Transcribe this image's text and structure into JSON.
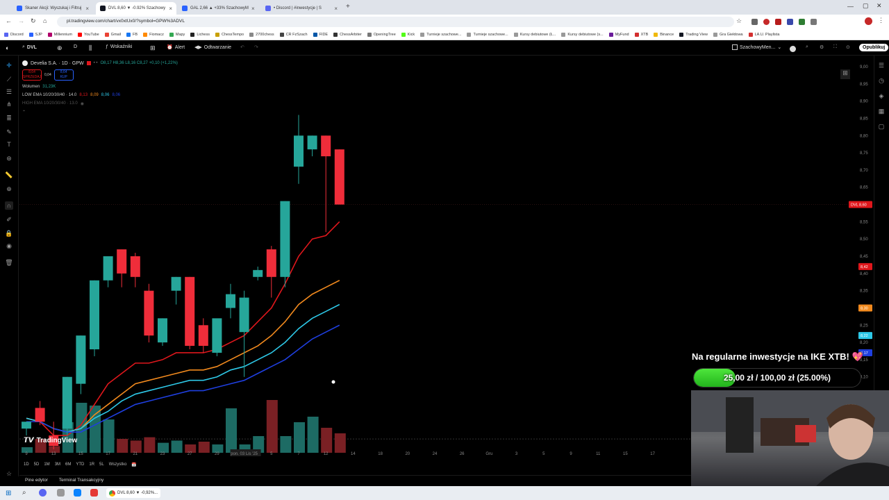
{
  "browser": {
    "tabs": [
      {
        "label": "Skaner Akcji: Wyszukaj i Filtruj",
        "color": "#2962ff"
      },
      {
        "label": "DVL 8,60 ▼ -0.92% Szachowy",
        "color": "#131722",
        "active": true
      },
      {
        "label": "GAL 2,66 ▲ +33% SzachowyM",
        "color": "#2962ff"
      },
      {
        "label": "• Discord | #inwestycje | S",
        "color": "#5865f2"
      }
    ],
    "url": "pl.tradingview.com/chart/vx0xtUx0/?symbol=GPW%3ADVL",
    "bookmarks": [
      {
        "label": "Discord",
        "color": "#5865f2"
      },
      {
        "label": "SJP",
        "color": "#2962ff"
      },
      {
        "label": "Millennium",
        "color": "#b0006a"
      },
      {
        "label": "YouTube",
        "color": "#ff0000"
      },
      {
        "label": "Gmail",
        "color": "#ea4335"
      },
      {
        "label": "FB",
        "color": "#1877f2"
      },
      {
        "label": "Fiomacz",
        "color": "#ff8a00"
      },
      {
        "label": "Mapy",
        "color": "#34a853"
      },
      {
        "label": "Lichess",
        "color": "#222"
      },
      {
        "label": "ChessTempo",
        "color": "#c8a000"
      },
      {
        "label": "2700chess",
        "color": "#888"
      },
      {
        "label": "CR FzSzach",
        "color": "#444"
      },
      {
        "label": "FIDE",
        "color": "#0057a8"
      },
      {
        "label": "ChessArbiter",
        "color": "#333"
      },
      {
        "label": "OpeningTree",
        "color": "#777"
      },
      {
        "label": "Kick",
        "color": "#53fc18"
      },
      {
        "label": "Turnieje szachowe...",
        "color": "#999"
      },
      {
        "label": "Turnieje szachowe...",
        "color": "#999"
      },
      {
        "label": "Kursy debiutowe (Ł...",
        "color": "#999"
      },
      {
        "label": "Kursy debiutowe (s...",
        "color": "#999"
      },
      {
        "label": "MyFund",
        "color": "#6a1b9a"
      },
      {
        "label": "XTB",
        "color": "#d32f2f"
      },
      {
        "label": "Binance",
        "color": "#f0b90b"
      },
      {
        "label": "Trading View",
        "color": "#131722"
      },
      {
        "label": "Gra Giełdowa",
        "color": "#999"
      },
      {
        "label": "LA.U. Playlista",
        "color": "#d32f2f"
      }
    ]
  },
  "toolbar": {
    "symbol": "DVL",
    "interval": "D",
    "indicators": "Wskaźniki",
    "alert": "Alert",
    "replay": "Odtwarzanie",
    "account": "SzachowyMen...",
    "publish": "Opublikuj"
  },
  "legend": {
    "symbol_title": "Develia S.A. · 1D · GPW",
    "ohlc": "O8,17 H8,36 L8,16 C8,27 +0,10 (+1,22%)",
    "volume_label": "Wolumen",
    "volume_value": "31,23K",
    "sell_price": "8,64",
    "sell_label": "SPRZEDAJ",
    "spread": "0,04",
    "buy_price": "8,64",
    "buy_label": "KUP",
    "low_ema": "LOW EMA 10/20/30/40 · 14.0",
    "low_ema_vals": [
      "8,13",
      "8,09",
      "8,06",
      "8,06"
    ],
    "high_ema": "HIGH EMA 10/20/30/40 · 13.0"
  },
  "price_axis": {
    "ticks": [
      "9,00",
      "8,95",
      "8,90",
      "8,85",
      "8,80",
      "8,75",
      "8,70",
      "8,65",
      "8,60",
      "8,55",
      "8,50",
      "8,45",
      "8,40",
      "8,35",
      "8,30",
      "8,25",
      "8,20",
      "8,15",
      "8,10",
      "8,05",
      "8,00",
      "7,95",
      "7,90"
    ],
    "badges": [
      {
        "label": "DVL  8,60",
        "value": 8.6,
        "color": "#e0171c"
      },
      {
        "label": "8,42",
        "value": 8.42,
        "color": "#e0171c"
      },
      {
        "label": "8,30",
        "value": 8.3,
        "color": "#f28a1e"
      },
      {
        "label": "8,22",
        "value": 8.22,
        "color": "#2ec9e8"
      },
      {
        "label": "8,17",
        "value": 8.17,
        "color": "#1f3fe0"
      }
    ]
  },
  "time_axis": {
    "labels": [
      "9",
      "13",
      "15",
      "17",
      "21",
      "23",
      "27",
      "29",
      "pon. 03 Lis '25",
      "5",
      "7",
      "12",
      "14",
      "18",
      "20",
      "24",
      "26",
      "Gru",
      "3",
      "5",
      "9",
      "11",
      "15",
      "17"
    ],
    "highlight": "pon. 03 Lis '25"
  },
  "chart_data": {
    "type": "candlestick",
    "y_range": [
      7.9,
      9.0
    ],
    "candles": [
      {
        "o": 7.95,
        "h": 7.97,
        "l": 7.93,
        "c": 7.97
      },
      {
        "o": 8.01,
        "h": 8.03,
        "l": 7.96,
        "c": 7.97
      },
      {
        "o": 7.93,
        "h": 7.97,
        "l": 7.89,
        "c": 7.9
      },
      {
        "o": 7.95,
        "h": 8.1,
        "l": 7.93,
        "c": 8.1
      },
      {
        "o": 8.08,
        "h": 8.22,
        "l": 8.05,
        "c": 8.22
      },
      {
        "o": 8.18,
        "h": 8.38,
        "l": 8.16,
        "c": 8.38
      },
      {
        "o": 8.38,
        "h": 8.45,
        "l": 8.36,
        "c": 8.45
      },
      {
        "o": 8.47,
        "h": 8.47,
        "l": 8.36,
        "c": 8.4
      },
      {
        "o": 8.45,
        "h": 8.46,
        "l": 8.36,
        "c": 8.39
      },
      {
        "o": 8.35,
        "h": 8.37,
        "l": 8.2,
        "c": 8.22
      },
      {
        "o": 8.2,
        "h": 8.27,
        "l": 8.19,
        "c": 8.27
      },
      {
        "o": 8.35,
        "h": 8.39,
        "l": 8.31,
        "c": 8.39
      },
      {
        "o": 8.39,
        "h": 8.39,
        "l": 8.18,
        "c": 8.19
      },
      {
        "o": 8.25,
        "h": 8.27,
        "l": 8.17,
        "c": 8.19
      },
      {
        "o": 8.17,
        "h": 8.26,
        "l": 8.16,
        "c": 8.27
      },
      {
        "o": 8.3,
        "h": 8.37,
        "l": 8.27,
        "c": 8.34
      },
      {
        "o": 8.23,
        "h": 8.35,
        "l": 8.1,
        "c": 8.33
      },
      {
        "o": 8.39,
        "h": 8.42,
        "l": 8.38,
        "c": 8.41
      },
      {
        "o": 8.47,
        "h": 8.48,
        "l": 8.33,
        "c": 8.39
      },
      {
        "o": 8.39,
        "h": 8.61,
        "l": 8.36,
        "c": 8.61
      },
      {
        "o": 8.71,
        "h": 8.86,
        "l": 8.66,
        "c": 8.8
      },
      {
        "o": 8.76,
        "h": 8.8,
        "l": 8.74,
        "c": 8.8
      },
      {
        "o": 8.8,
        "h": 8.8,
        "l": 8.52,
        "c": 8.74
      },
      {
        "o": 8.76,
        "h": 8.76,
        "l": 8.6,
        "c": 8.6
      }
    ],
    "volume_relative": [
      0.1,
      0.25,
      0.12,
      0.55,
      0.9,
      0.85,
      0.6,
      0.25,
      0.22,
      0.28,
      0.18,
      0.22,
      0.15,
      0.2,
      0.15,
      0.8,
      0.15,
      0.3,
      0.95,
      0.3,
      0.55,
      0.65,
      0.45,
      0.35
    ],
    "ema_low": {
      "ema10": [
        7.98,
        7.97,
        7.93,
        7.93,
        7.96,
        8.02,
        8.08,
        8.11,
        8.14,
        8.14,
        8.15,
        8.17,
        8.17,
        8.17,
        8.18,
        8.2,
        8.22,
        8.26,
        8.3,
        8.37,
        8.45,
        8.5,
        8.51,
        8.55
      ],
      "ema20": [
        7.98,
        7.97,
        7.95,
        7.94,
        7.95,
        7.99,
        8.02,
        8.05,
        8.08,
        8.09,
        8.1,
        8.11,
        8.12,
        8.12,
        8.13,
        8.15,
        8.17,
        8.19,
        8.22,
        8.26,
        8.31,
        8.34,
        8.36,
        8.38
      ],
      "ema30": [
        7.98,
        7.97,
        7.95,
        7.94,
        7.95,
        7.98,
        8.0,
        8.03,
        8.05,
        8.06,
        8.07,
        8.08,
        8.09,
        8.09,
        8.1,
        8.12,
        8.13,
        8.15,
        8.17,
        8.2,
        8.24,
        8.27,
        8.29,
        8.31
      ],
      "ema40": [
        7.97,
        7.97,
        7.95,
        7.94,
        7.94,
        7.96,
        7.98,
        8.0,
        8.02,
        8.03,
        8.04,
        8.05,
        8.06,
        8.06,
        8.07,
        8.08,
        8.09,
        8.11,
        8.13,
        8.15,
        8.18,
        8.21,
        8.23,
        8.25
      ]
    }
  },
  "bottom": {
    "ranges": [
      "1D",
      "5D",
      "1M",
      "3M",
      "6M",
      "YTD",
      "1R",
      "5L",
      "Wszystko"
    ],
    "panels": [
      "Pine edytor",
      "Terminal Transakcyjny"
    ]
  },
  "overlay": {
    "title": "Na regularne inwestycje na IKE XTB! 💖",
    "progress_text": "25,00 zł / 100,00 zł (25.00%)",
    "progress_fraction": 0.25
  },
  "tradingview_logo": "TradingView",
  "taskbar": {
    "active_window": "DVL 8,60 ▼ -0,92%..."
  }
}
